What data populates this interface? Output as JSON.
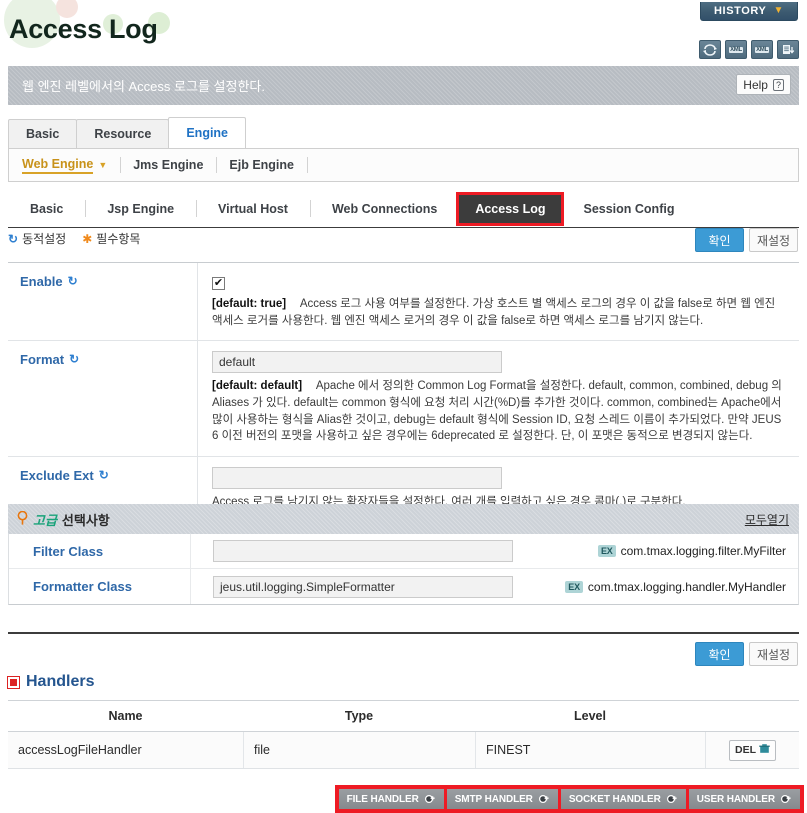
{
  "header": {
    "title": "Access Log",
    "history_label": "HISTORY",
    "history_caret": "▼",
    "icons": [
      {
        "name": "refresh-icon",
        "label": ""
      },
      {
        "name": "xml-upload-icon",
        "label": "XML"
      },
      {
        "name": "xml-download-icon",
        "label": "XML"
      },
      {
        "name": "export-icon",
        "label": ""
      }
    ],
    "description": "웹 엔진 레벨에서의 Access 로그를 설정한다.",
    "help_label": "Help",
    "help_mark": "?"
  },
  "tabs_level1": [
    {
      "label": "Basic",
      "active": false
    },
    {
      "label": "Resource",
      "active": false
    },
    {
      "label": "Engine",
      "active": true
    }
  ],
  "engine_bar": [
    {
      "label": "Web Engine",
      "selected": true,
      "caret": "▼"
    },
    {
      "label": "Jms Engine",
      "selected": false,
      "caret": ""
    },
    {
      "label": "Ejb Engine",
      "selected": false,
      "caret": ""
    }
  ],
  "tabs_level3": [
    {
      "label": "Basic",
      "active": false
    },
    {
      "label": "Jsp Engine",
      "active": false
    },
    {
      "label": "Virtual Host",
      "active": false
    },
    {
      "label": "Web Connections",
      "active": false
    },
    {
      "label": "Access Log",
      "active": true
    },
    {
      "label": "Session Config",
      "active": false
    }
  ],
  "legend": {
    "dynamic_icon": "↻",
    "dynamic_label": "동적설정",
    "required_icon": "✱",
    "required_label": "필수항목"
  },
  "actions": {
    "ok_label": "확인",
    "reset_label": "재설정"
  },
  "properties": [
    {
      "label": "Enable",
      "dynamic_icon": "↻",
      "control": "checkbox",
      "checked_mark": "✔",
      "value": "",
      "desc_default": "[default: true]",
      "desc_text": "Access 로그 사용 여부를 설정한다. 가상 호스트 별 액세스 로그의 경우 이 값을 false로 하면 웹 엔진 액세스 로거를 사용한다. 웹 엔진 액세스 로거의 경우 이 값을 false로 하면 액세스 로그를 남기지 않는다."
    },
    {
      "label": "Format",
      "dynamic_icon": "↻",
      "control": "text",
      "value": "default",
      "desc_default": "[default: default]",
      "desc_text": "Apache 에서 정의한 Common Log Format을 설정한다. default, common, combined, debug 의 Aliases 가 있다. default는 common 형식에 요청 처리 시간(%D)를 추가한 것이다. common, combined는 Apache에서 많이 사용하는 형식을 Alias한 것이고, debug는 default 형식에 Session ID, 요청 스레드 이름이 추가되었다. 만약 JEUS 6 이전 버전의 포맷을 사용하고 싶은 경우에는 6deprecated 로 설정한다. 단, 이 포맷은 동적으로 변경되지 않는다."
    },
    {
      "label": "Exclude Ext",
      "dynamic_icon": "↻",
      "control": "text",
      "value": "",
      "desc_default": "",
      "desc_text": "Access 로그를 남기지 않는 확장자들을 설정한다. 여러 개를 입력하고 싶은 경우 콤마(,)로 구분한다."
    }
  ],
  "advanced": {
    "pin_icon": "📍",
    "title_ko": "고급",
    "title_kr": "선택사항",
    "open_all_label": "모두열기",
    "rows": [
      {
        "label": "Filter Class",
        "value": "",
        "ex_badge": "EX",
        "ex_text": "com.tmax.logging.filter.MyFilter"
      },
      {
        "label": "Formatter Class",
        "value": "jeus.util.logging.SimpleFormatter",
        "ex_badge": "EX",
        "ex_text": "com.tmax.logging.handler.MyHandler"
      }
    ]
  },
  "handlers": {
    "section_title": "Handlers",
    "columns": [
      "Name",
      "Type",
      "Level"
    ],
    "rows": [
      {
        "name": "accessLogFileHandler",
        "type": "file",
        "level": "FINEST",
        "delete_label": "DEL",
        "delete_icon": "🗑"
      }
    ],
    "buttons": [
      {
        "label": "FILE HANDLER",
        "icon": "⊕"
      },
      {
        "label": "SMTP HANDLER",
        "icon": "⊕"
      },
      {
        "label": "SOCKET HANDLER",
        "icon": "⊕"
      },
      {
        "label": "USER HANDLER",
        "icon": "⊕"
      }
    ]
  },
  "colors": {
    "accent_blue": "#2f68a8",
    "button_blue": "#3c9bd5",
    "highlight_red": "#ee1b24",
    "gold": "#d8a227",
    "dark_tab": "#3c3c3c"
  }
}
